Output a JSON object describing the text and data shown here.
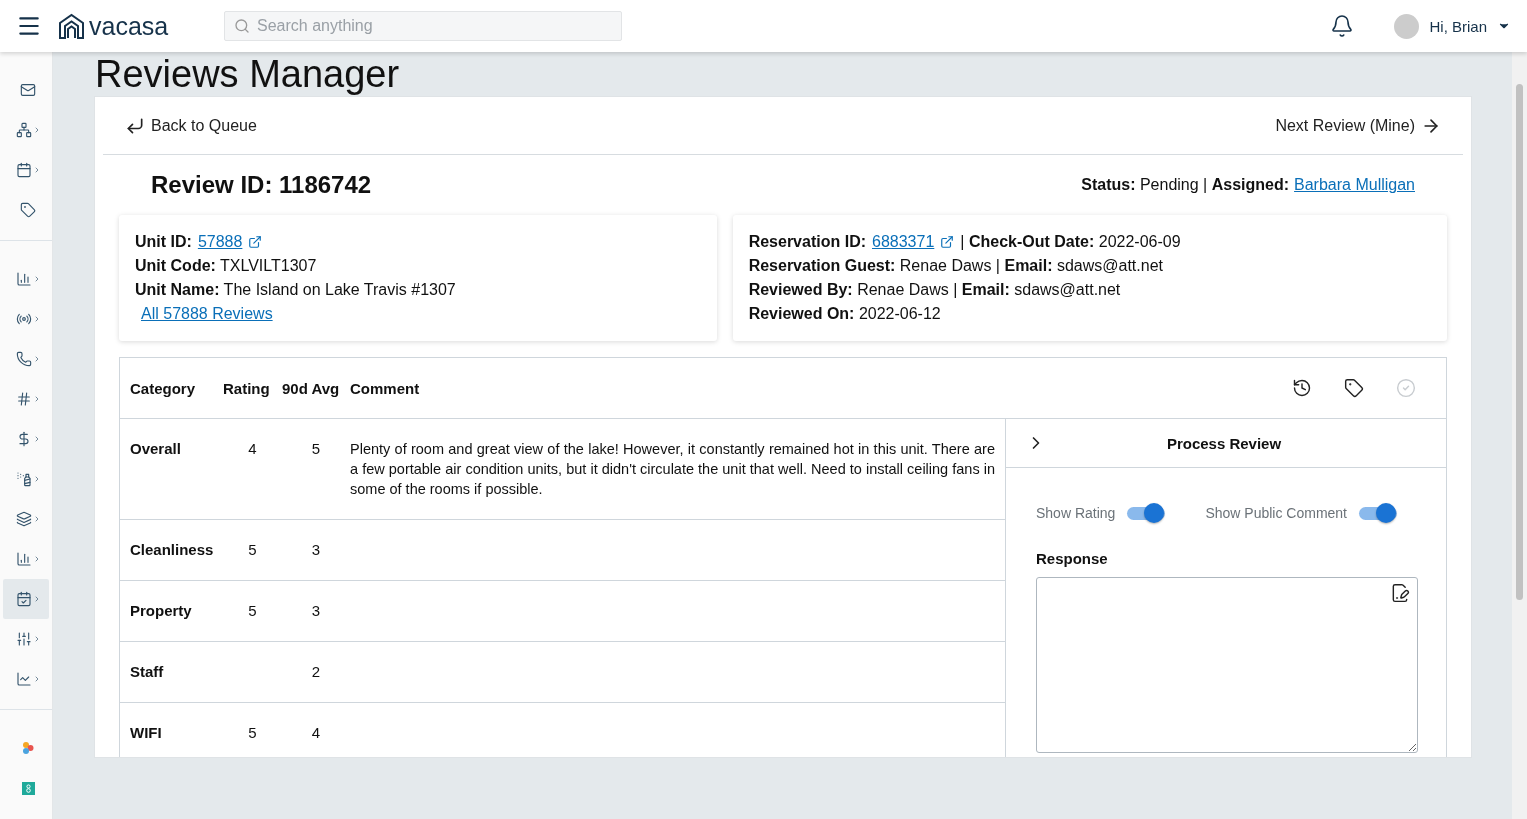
{
  "header": {
    "brand": "vacasa",
    "search": {
      "placeholder": "Search anything"
    },
    "greeting": "Hi, Brian"
  },
  "sidebar": {
    "groups": [
      [
        {
          "kind": "mail",
          "selected": false,
          "expandable": false
        },
        {
          "kind": "org",
          "selected": false,
          "expandable": true
        },
        {
          "kind": "calendar",
          "selected": false,
          "expandable": true
        },
        {
          "kind": "tag",
          "selected": false,
          "expandable": false
        }
      ],
      [
        {
          "kind": "bars",
          "selected": false,
          "expandable": true
        },
        {
          "kind": "radio",
          "selected": false,
          "expandable": true
        },
        {
          "kind": "phone",
          "selected": false,
          "expandable": true
        },
        {
          "kind": "hash",
          "selected": false,
          "expandable": true
        },
        {
          "kind": "dollar",
          "selected": false,
          "expandable": true
        },
        {
          "kind": "spray",
          "selected": false,
          "expandable": true
        },
        {
          "kind": "layers",
          "selected": false,
          "expandable": true
        },
        {
          "kind": "bars",
          "selected": false,
          "expandable": true
        },
        {
          "kind": "calendar-check",
          "selected": true,
          "expandable": true
        },
        {
          "kind": "sliders",
          "selected": false,
          "expandable": true
        },
        {
          "kind": "chart-home",
          "selected": false,
          "expandable": true
        }
      ],
      [
        {
          "kind": "dots-app",
          "selected": false,
          "expandable": false
        },
        {
          "kind": "square-app",
          "selected": false,
          "expandable": false
        }
      ]
    ]
  },
  "page": {
    "title": "Reviews Manager"
  },
  "nav": {
    "back": "Back to Queue",
    "next": "Next Review (Mine)"
  },
  "review": {
    "id_label": "Review ID: 1186742",
    "status": "**Status:** Pending | **Assigned:**",
    "assignee": "Barbara Mulligan"
  },
  "info_cards": [
    {
      "lines": [
        [
          {
            "kind": "text",
            "text": "**Unit ID:**"
          },
          {
            "kind": "link",
            "text": "57888",
            "external": true
          }
        ],
        [
          {
            "kind": "text",
            "text": "**Unit Code:** TXLVILT1307"
          }
        ],
        [
          {
            "kind": "text",
            "text": "**Unit Name:** The Island on Lake Travis #1307"
          }
        ],
        [
          {
            "kind": "link",
            "text": "All 57888 Reviews",
            "external": false
          }
        ]
      ]
    },
    {
      "lines": [
        [
          {
            "kind": "text",
            "text": "**Reservation ID:**"
          },
          {
            "kind": "link",
            "text": "6883371",
            "external": true
          },
          {
            "kind": "text",
            "text": "|  **Check-Out Date:** 2022-06-09"
          }
        ],
        [
          {
            "kind": "text",
            "text": "**Reservation Guest:** Renae Daws | **Email:** sdaws@att.net"
          }
        ],
        [
          {
            "kind": "text",
            "text": "**Reviewed By:** Renae Daws | **Email:** sdaws@att.net"
          }
        ],
        [
          {
            "kind": "text",
            "text": "**Reviewed On:** 2022-06-12"
          }
        ]
      ]
    }
  ],
  "table": {
    "columns": [
      "Category",
      "Rating",
      "90d Avg",
      "Comment"
    ],
    "actions": [
      {
        "kind": "history",
        "disabled": false
      },
      {
        "kind": "tag",
        "disabled": false
      },
      {
        "kind": "check",
        "disabled": true
      }
    ],
    "rows": [
      {
        "category": "Overall",
        "rating": "4",
        "avg": "5",
        "comment": "Plenty of room and great view of the lake! However, it constantly remained hot in this unit. There are a few portable air condition units, but it didn't circulate the unit that well. Need to install ceiling fans in some of the rooms if possible."
      },
      {
        "category": "Cleanliness",
        "rating": "5",
        "avg": "3"
      },
      {
        "category": "Property",
        "rating": "5",
        "avg": "3"
      },
      {
        "category": "Staff",
        "avg": "2"
      },
      {
        "category": "WIFI",
        "rating": "5",
        "avg": "4"
      }
    ]
  },
  "process": {
    "title": "Process Review",
    "expanded": false,
    "toggles": [
      {
        "label": "Show Rating",
        "on": true
      },
      {
        "label": "Show Public Comment",
        "on": true
      }
    ],
    "response_label": "Response"
  }
}
